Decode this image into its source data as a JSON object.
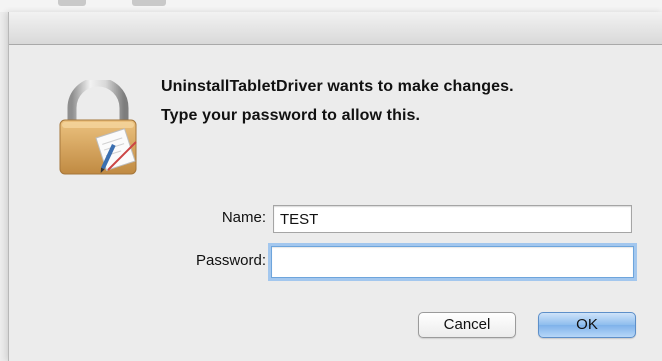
{
  "dialog": {
    "message_line1": "UninstallTabletDriver wants to make changes.",
    "message_line2": "Type your password to allow this.",
    "icon": "lock-icon"
  },
  "form": {
    "name_label": "Name:",
    "name_value": "TEST",
    "password_label": "Password:",
    "password_value": ""
  },
  "buttons": {
    "cancel_label": "Cancel",
    "ok_label": "OK"
  },
  "colors": {
    "window_bg": "#ececec",
    "default_button": "#8ebdee",
    "focus_ring": "#a3c7ee",
    "lock_body": "#d6a35c"
  }
}
